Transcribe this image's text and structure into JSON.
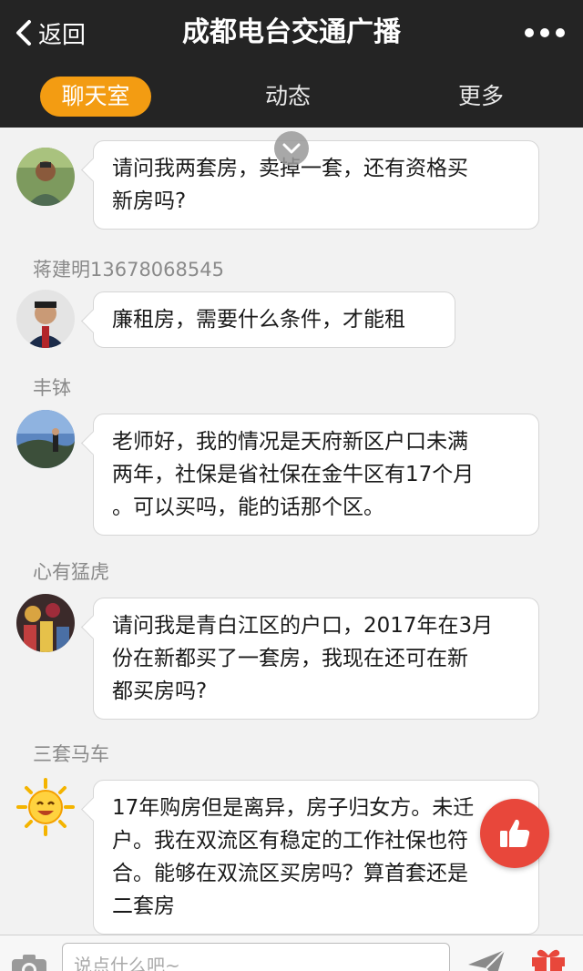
{
  "header": {
    "back_label": "返回",
    "title": "成都电台交通广播"
  },
  "tabs": [
    {
      "label": "聊天室",
      "active": true
    },
    {
      "label": "动态",
      "active": false
    },
    {
      "label": "更多",
      "active": false
    }
  ],
  "messages": [
    {
      "user": "",
      "lines": [
        "请问我两套房，卖掉一套，还有资格买",
        "新房吗?"
      ]
    },
    {
      "user": "蒋建明13678068545",
      "lines": [
        "廉租房，需要什么条件，才能租"
      ]
    },
    {
      "user": "丰钵",
      "lines": [
        "老师好，我的情况是天府新区户口未满",
        "两年，社保是省社保在金牛区有17个月",
        "。可以买吗，能的话那个区。"
      ]
    },
    {
      "user": "心有猛虎",
      "lines": [
        "请问我是青白江区的户口，2017年在3月",
        "份在新都买了一套房，我现在还可在新",
        "都买房吗?"
      ]
    },
    {
      "user": "三套马车",
      "lines": [
        "17年购房但是离异，房子归女方。未迁",
        "户。我在双流区有稳定的工作社保也符",
        "合。能够在双流区买房吗？算首套还是",
        "二套房"
      ]
    }
  ],
  "input": {
    "placeholder": "说点什么吧~"
  },
  "colors": {
    "header_bg": "#242424",
    "active_tab": "#f39c12",
    "like_button": "#e8473b"
  },
  "icons": [
    "back-chevron-icon",
    "more-dots-icon",
    "chevron-down-icon",
    "thumbs-up-icon",
    "camera-icon",
    "send-icon",
    "gift-icon"
  ]
}
